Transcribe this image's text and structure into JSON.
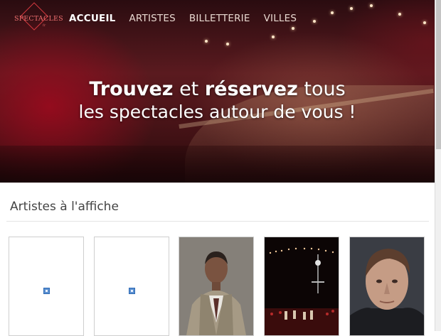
{
  "logo": {
    "text": "SPECTACLES",
    "sub": "fr"
  },
  "nav": {
    "items": [
      {
        "label": "ACCUEIL",
        "active": true
      },
      {
        "label": "ARTISTES",
        "active": false
      },
      {
        "label": "BILLETTERIE",
        "active": false
      },
      {
        "label": "VILLES",
        "active": false
      }
    ]
  },
  "hero": {
    "line1_bold1": "Trouvez",
    "line1_mid": " et ",
    "line1_bold2": "réservez",
    "line1_end": " tous",
    "line2": "les spectacles autour de vous !"
  },
  "section": {
    "title": "Artistes à l'affiche"
  },
  "artists": [
    {
      "image": "broken-image-icon"
    },
    {
      "image": "broken-image-icon"
    },
    {
      "image": "artist-portrait-man-suit"
    },
    {
      "image": "concert-stage-photo"
    },
    {
      "image": "artist-portrait-man-closeup"
    }
  ],
  "colors": {
    "logo_red": "#d93a40",
    "nav_text": "#e8d8d0",
    "hero_bg": "#4a1418"
  }
}
